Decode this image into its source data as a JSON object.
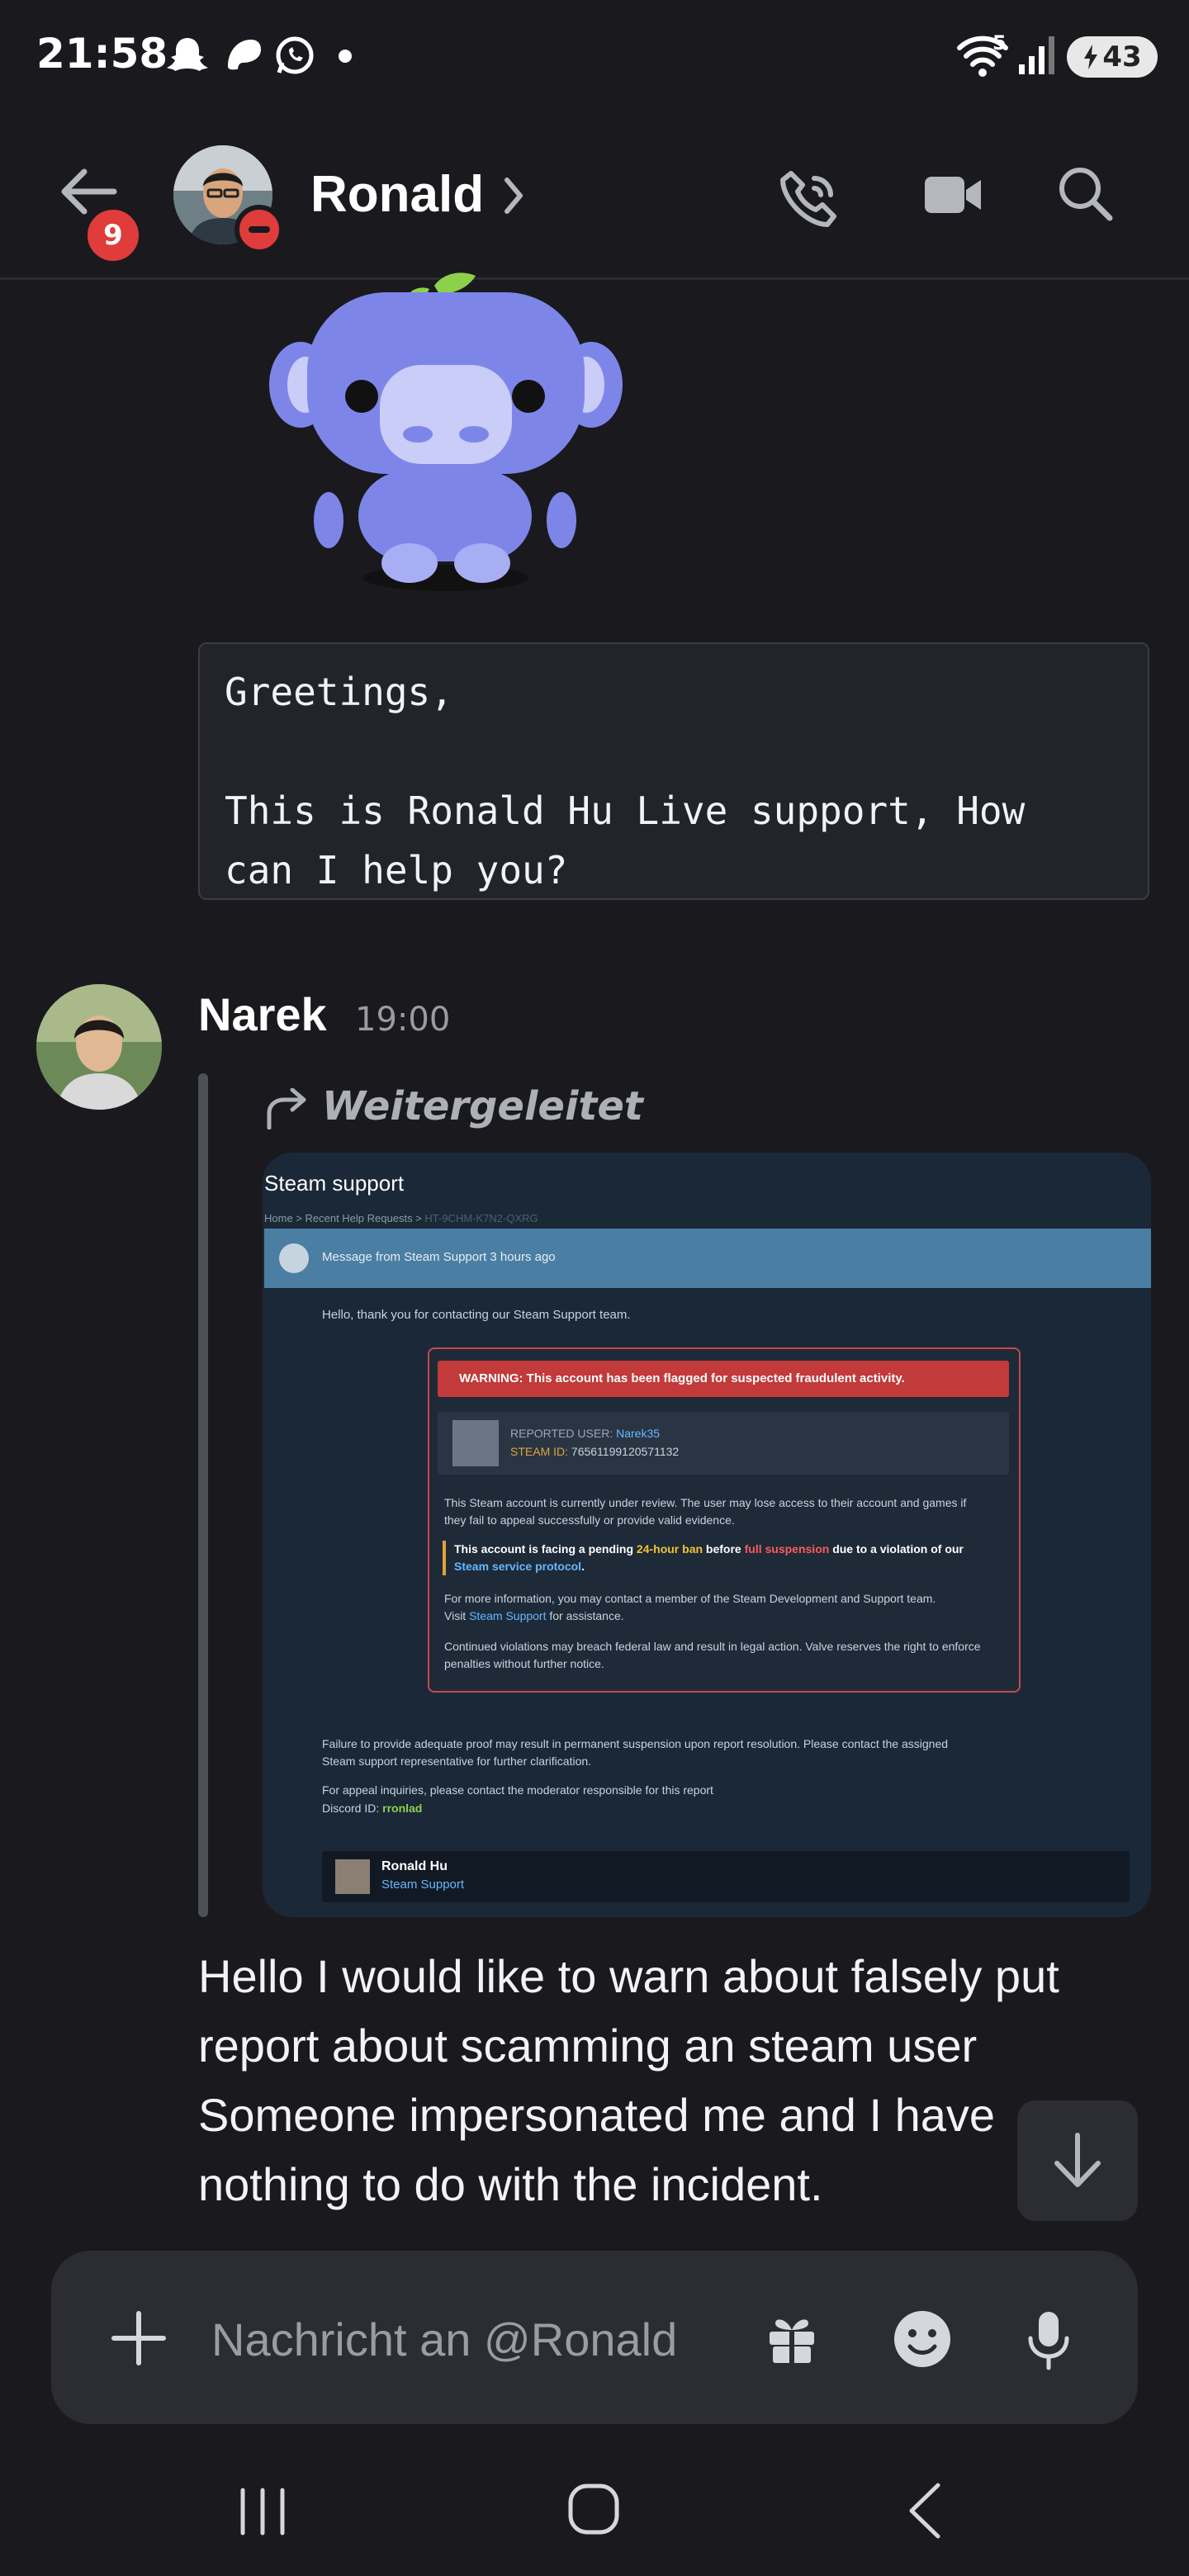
{
  "status_bar": {
    "time": "21:58",
    "battery": "43",
    "wifi_badge": "5"
  },
  "header": {
    "back_badge": "9",
    "contact_name": "Ronald"
  },
  "greeting": {
    "text": "Greetings,\n\nThis is Ronald Hu Live support, How\ncan I help you?"
  },
  "narek": {
    "name": "Narek",
    "time": "19:00",
    "forwarded_label": "Weitergeleitet",
    "message": "Hello I would like to warn about falsely put report about scamming an steam user Someone impersonated me and I have nothing to do with the incident."
  },
  "screenshot": {
    "title": "Steam support",
    "breadcrumb": "Home > Recent Help Requests > ",
    "breadcrumb_id": "HT-9CHM-K7N2-QXRG",
    "bar_text": "Message from Steam Support 3 hours ago",
    "intro": "Hello, thank you for contacting our Steam Support team.",
    "warning": "WARNING: This account has been flagged for suspected fraudulent activity.",
    "reported_label": "REPORTED USER: ",
    "reported_user": "Narek35",
    "steam_id_label": "STEAM ID: ",
    "steam_id": "76561199120571132",
    "review_text": "This Steam account is currently under review. The user may lose access to their account and games if they fail to appeal successfully or provide valid evidence.",
    "ban_1": "This account is facing a pending ",
    "ban_2": "24-hour ban",
    "ban_3": " before ",
    "ban_4": "full suspension",
    "ban_5": " due to a violation of our",
    "ban_6": "Steam service protocol",
    "ban_7": ".",
    "more_info_1": "For more information, you may contact a member of the Steam Development and Support team.",
    "more_info_2": "Visit ",
    "more_info_link": "Steam Support",
    "more_info_3": " for assistance.",
    "continued": "Continued violations may breach federal law and result in legal action. Valve reserves the right to enforce penalties without further notice.",
    "failure": "Failure to provide adequate proof may result in permanent suspension upon report resolution. Please contact the assigned Steam support representative for further clarification.",
    "appeal": "For appeal inquiries, please contact the moderator responsible for this report",
    "discord_label": "Discord ID: ",
    "discord_id": "rronlad",
    "signer_name": "Ronald Hu",
    "signer_role": "Steam Support"
  },
  "composer": {
    "placeholder": "Nachricht an @Ronald"
  },
  "icons": [
    "back-arrow-icon",
    "phone-icon",
    "video-icon",
    "search-icon",
    "plus-icon",
    "gift-icon",
    "emoji-icon",
    "mic-icon",
    "arrow-down-icon",
    "forward-icon",
    "recent-apps-icon",
    "home-icon",
    "nav-back-icon"
  ]
}
